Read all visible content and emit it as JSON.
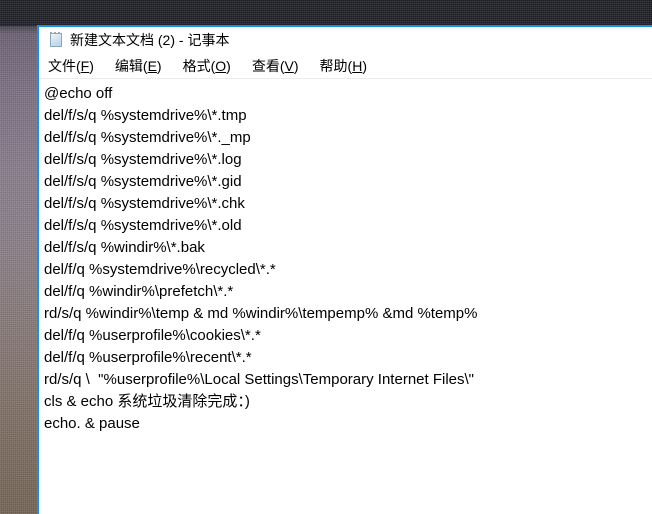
{
  "desktop": {
    "wallpaper_name": "textured-wallpaper",
    "top_band_color": "#24252c",
    "accent_color": "#1b8fe0"
  },
  "window": {
    "icon_name": "notepad-icon",
    "title": "新建文本文档 (2) - 记事本",
    "menu": [
      {
        "name": "file",
        "label": "文件(F)",
        "mnemonic": "F"
      },
      {
        "name": "edit",
        "label": "编辑(E)",
        "mnemonic": "E"
      },
      {
        "name": "format",
        "label": "格式(O)",
        "mnemonic": "O"
      },
      {
        "name": "view",
        "label": "查看(V)",
        "mnemonic": "V"
      },
      {
        "name": "help",
        "label": "帮助(H)",
        "mnemonic": "H"
      }
    ],
    "document": {
      "lines": [
        "@echo off",
        "del/f/s/q %systemdrive%\\*.tmp",
        "del/f/s/q %systemdrive%\\*._mp",
        "del/f/s/q %systemdrive%\\*.log",
        "del/f/s/q %systemdrive%\\*.gid",
        "del/f/s/q %systemdrive%\\*.chk",
        "del/f/s/q %systemdrive%\\*.old",
        "del/f/s/q %windir%\\*.bak",
        "del/f/q %systemdrive%\\recycled\\*.*",
        "del/f/q %windir%\\prefetch\\*.*",
        "rd/s/q %windir%\\temp & md %windir%\\tempemp% &md %temp%",
        "del/f/q %userprofile%\\cookies\\*.*",
        "del/f/q %userprofile%\\recent\\*.*",
        "rd/s/q \\  \"%userprofile%\\Local Settings\\Temporary Internet Files\\\"",
        "cls & echo 系统垃圾清除完成：)",
        "echo. & pause"
      ]
    }
  }
}
